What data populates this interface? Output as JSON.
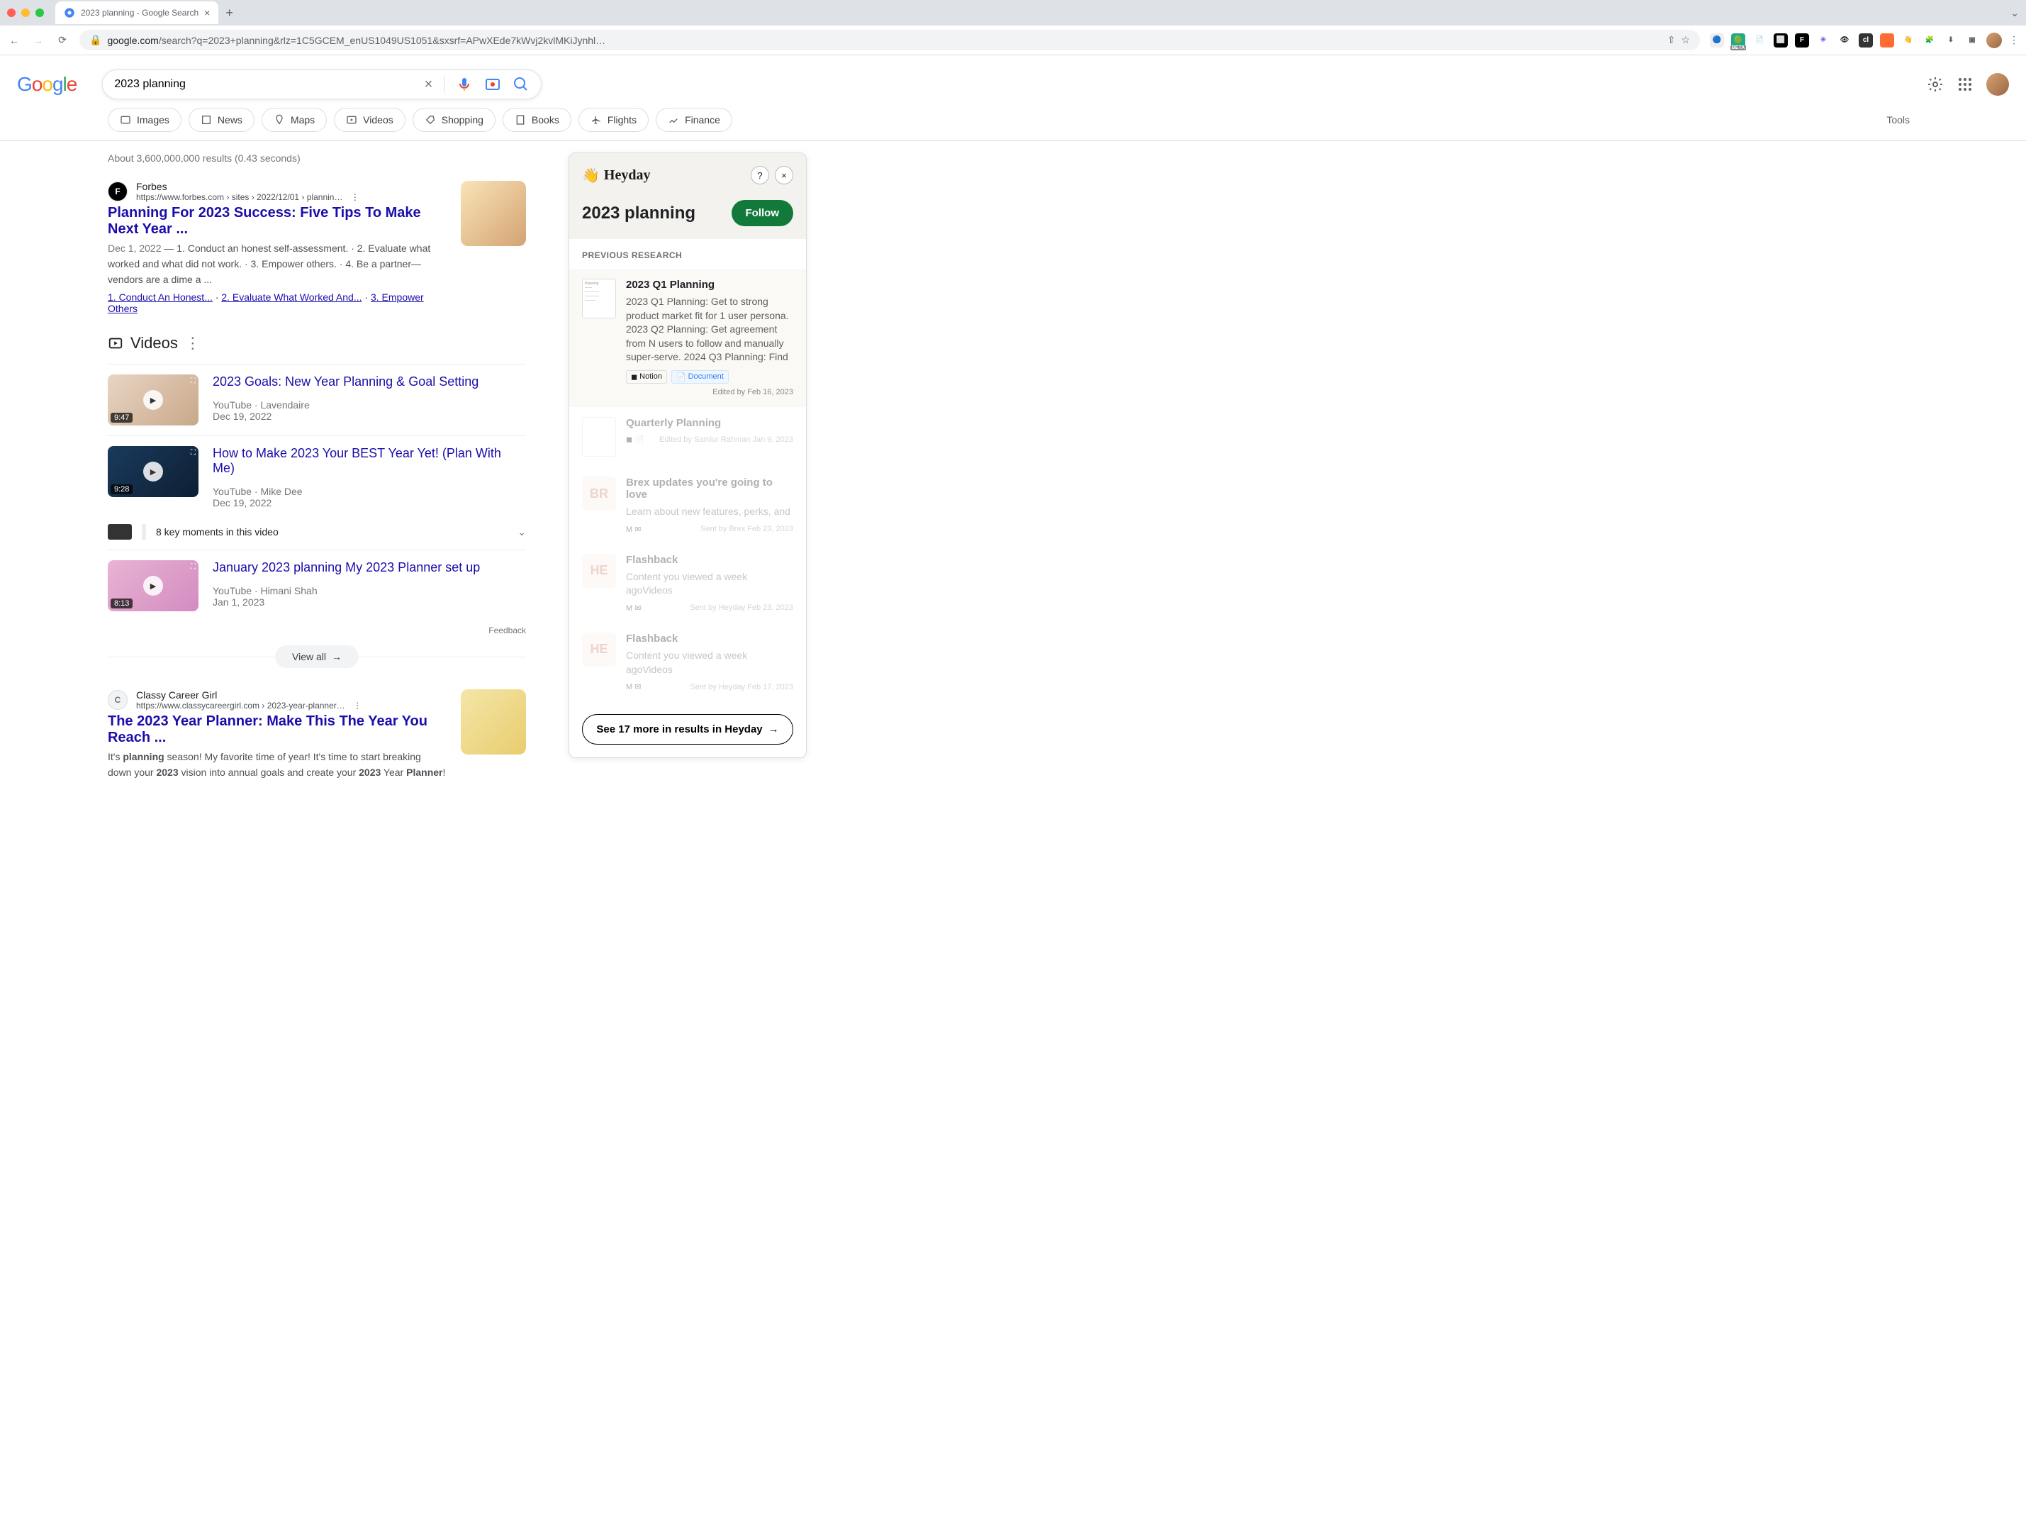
{
  "browser": {
    "tab_title": "2023 planning - Google Search",
    "url_display": "google.com/search?q=2023+planning&rlz=1C5GCEM_enUS1049US1051&sxsrf=APwXEde7kWvj2kvlMKiJynhl…",
    "url_host": "google.com"
  },
  "search": {
    "query": "2023 planning",
    "clear_tooltip": "Clear"
  },
  "chips": [
    {
      "icon": "image",
      "label": "Images"
    },
    {
      "icon": "news",
      "label": "News"
    },
    {
      "icon": "map",
      "label": "Maps"
    },
    {
      "icon": "video",
      "label": "Videos"
    },
    {
      "icon": "tag",
      "label": "Shopping"
    },
    {
      "icon": "book",
      "label": "Books"
    },
    {
      "icon": "plane",
      "label": "Flights"
    },
    {
      "icon": "finance",
      "label": "Finance"
    }
  ],
  "tools_label": "Tools",
  "stats": "About 3,600,000,000 results (0.43 seconds)",
  "results": {
    "r1": {
      "site": "Forbes",
      "url": "https://www.forbes.com › sites › 2022/12/01 › plannin…",
      "title": "Planning For 2023 Success: Five Tips To Make Next Year ...",
      "date": "Dec 1, 2022",
      "snippet": " — 1. Conduct an honest self-assessment. · 2. Evaluate what worked and what did not work. · 3. Empower others. · 4. Be a partner—vendors are a dime a ...",
      "sitelinks": [
        "1. Conduct An Honest...",
        "2. Evaluate What Worked And...",
        "3. Empower Others"
      ]
    },
    "r2": {
      "site": "Classy Career Girl",
      "url": "https://www.classycareergirl.com › 2023-year-planner…",
      "title": "The 2023 Year Planner: Make This The Year You Reach ...",
      "snippet_html": "It's <strong>planning</strong> season! My favorite time of year! It's time to start breaking down your <strong>2023</strong> vision into annual goals and create your <strong>2023</strong> Year <strong>Planner</strong>!"
    }
  },
  "videos": {
    "heading": "Videos",
    "items": [
      {
        "title": "2023 Goals: New Year Planning & Goal Setting",
        "source": "YouTube · Lavendaire",
        "date": "Dec 19, 2022",
        "dur": "9:47"
      },
      {
        "title": "How to Make 2023 Your BEST Year Yet! (Plan With Me)",
        "source": "YouTube · Mike Dee",
        "date": "Dec 19, 2022",
        "dur": "9:28",
        "moments": "8 key moments in this video"
      },
      {
        "title": "January 2023 planning My 2023 Planner set up",
        "source": "YouTube · Himani Shah",
        "date": "Jan 1, 2023",
        "dur": "8:13"
      }
    ],
    "feedback": "Feedback",
    "viewall": "View all"
  },
  "heyday": {
    "brand": "Heyday",
    "title": "2023 planning",
    "follow": "Follow",
    "section": "PREVIOUS RESEARCH",
    "items": [
      {
        "title": "2023 Q1 Planning",
        "desc": "2023 Q1 Planning: Get to strong product market fit for 1 user persona. 2023 Q2 Planning: Get agreement from N users to follow and manually super-serve. 2024 Q3 Planning: Find",
        "tag1": "Notion",
        "tag2": "Document",
        "meta": "Edited by Feb 16, 2023"
      },
      {
        "title": "Quarterly Planning",
        "meta": "Edited by Samiur Rahman Jan 9, 2023"
      },
      {
        "title": "Brex updates you're going to love",
        "desc": "Learn about new features, perks, and",
        "avatar": "BR",
        "meta": "Sent by Brex Feb 23, 2023"
      },
      {
        "title": "Flashback",
        "desc": "Content you viewed a week agoVideos",
        "avatar": "HE",
        "meta": "Sent by Heyday Feb 23, 2023"
      },
      {
        "title": "Flashback",
        "desc": "Content you viewed a week agoVideos",
        "avatar": "HE",
        "meta": "Sent by Heyday Feb 17, 2023"
      }
    ],
    "more": "See 17 more in results in Heyday"
  }
}
